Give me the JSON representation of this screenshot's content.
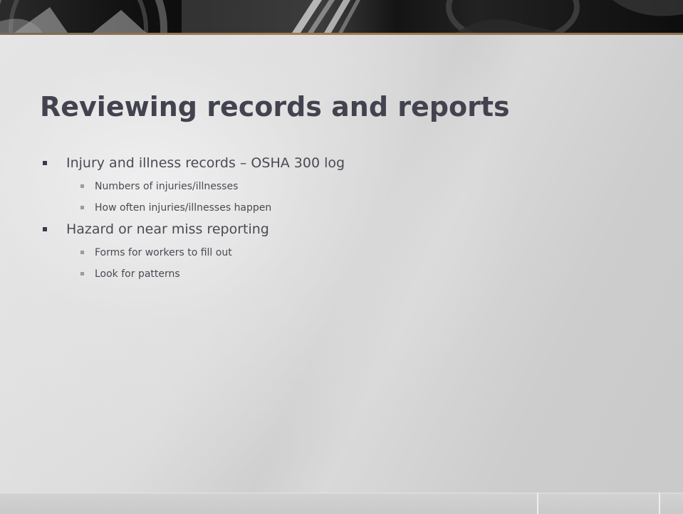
{
  "slide": {
    "title": "Reviewing records and reports",
    "bullets": [
      {
        "text": "Injury and illness records – OSHA 300 log",
        "sub": [
          "Numbers of injuries/illnesses",
          "How often injuries/illnesses happen"
        ]
      },
      {
        "text": "Hazard or near miss reporting",
        "sub": [
          "Forms for workers to fill out",
          "Look for patterns"
        ]
      }
    ]
  },
  "colors": {
    "title": "#43434f",
    "body_text": "#4a4a54",
    "banner_accent": "#a37a4f"
  }
}
